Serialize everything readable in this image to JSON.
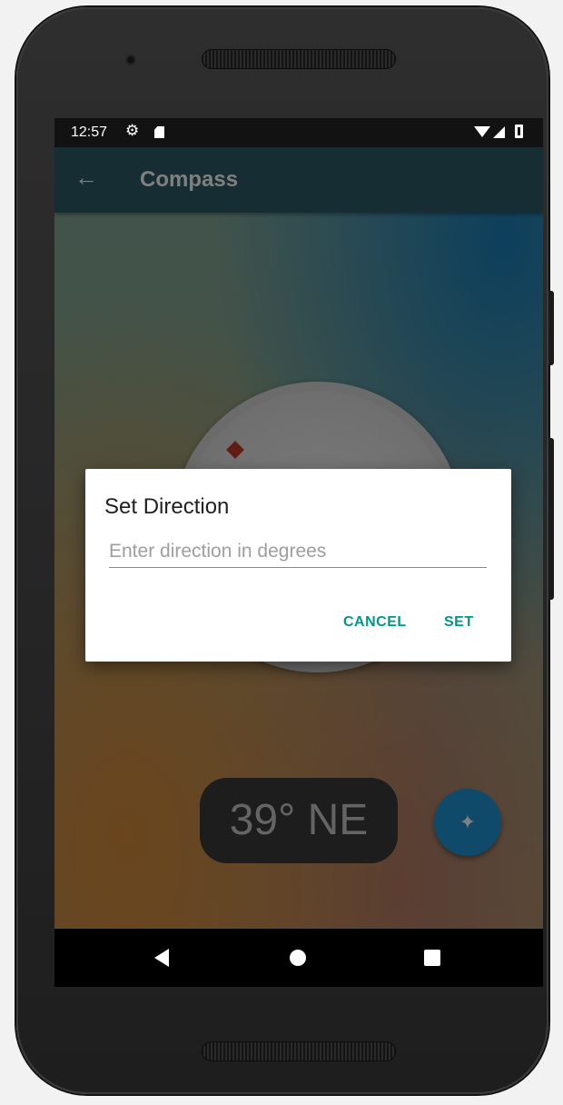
{
  "status_bar": {
    "time": "12:57",
    "icons": [
      "settings-icon",
      "sd-card-icon",
      "wifi-icon",
      "cell-signal-icon",
      "battery-icon"
    ]
  },
  "toolbar": {
    "back_icon": "←",
    "title": "Compass"
  },
  "readout": {
    "text": "39° NE"
  },
  "fab": {
    "icon": "compass-rose-icon",
    "glyph": "✦",
    "color": "#1f95d6"
  },
  "dialog": {
    "title": "Set Direction",
    "input_placeholder": "Enter direction in degrees",
    "input_value": "",
    "cancel_label": "CANCEL",
    "set_label": "SET",
    "accent": "#009688"
  },
  "nav_bar": {
    "icons": [
      "back-triangle-icon",
      "home-circle-icon",
      "recents-square-icon"
    ]
  }
}
